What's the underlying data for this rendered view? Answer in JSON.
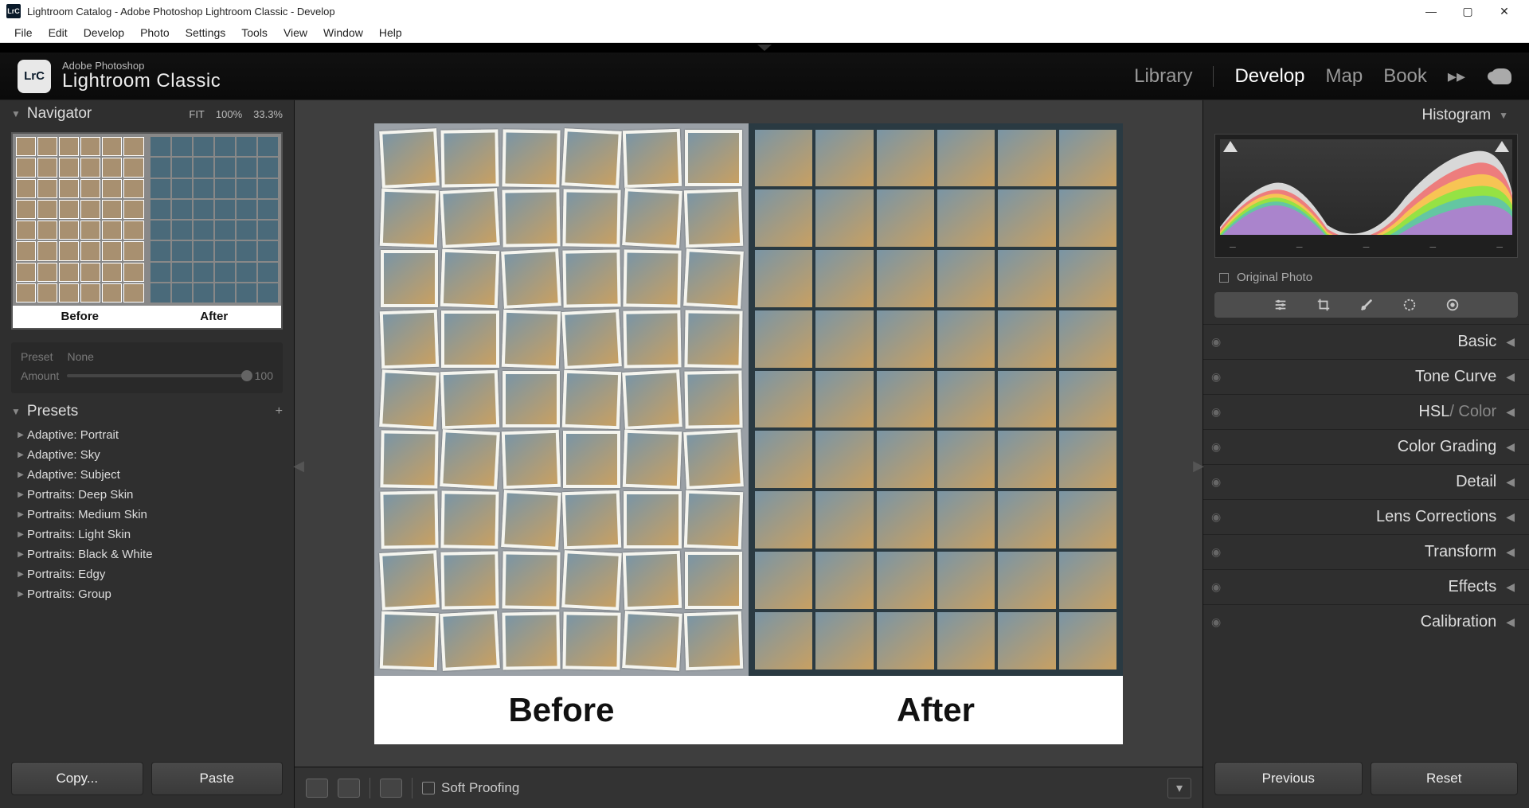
{
  "window": {
    "title": "Lightroom Catalog - Adobe Photoshop Lightroom Classic - Develop",
    "app_icon": "LrC"
  },
  "menu": [
    "File",
    "Edit",
    "Develop",
    "Photo",
    "Settings",
    "Tools",
    "View",
    "Window",
    "Help"
  ],
  "brand": {
    "sup": "Adobe Photoshop",
    "main": "Lightroom Classic",
    "badge": "LrC"
  },
  "modules": {
    "items": [
      "Library",
      "Develop",
      "Map",
      "Book"
    ],
    "active": "Develop"
  },
  "navigator": {
    "title": "Navigator",
    "zoom": [
      "FIT",
      "100%",
      "33.3%"
    ],
    "before": "Before",
    "after": "After"
  },
  "preset_amount": {
    "preset_label": "Preset",
    "preset_value": "None",
    "amount_label": "Amount",
    "amount_value": "100"
  },
  "presets": {
    "title": "Presets",
    "items": [
      "Adaptive: Portrait",
      "Adaptive: Sky",
      "Adaptive: Subject",
      "Portraits: Deep Skin",
      "Portraits: Medium Skin",
      "Portraits: Light Skin",
      "Portraits: Black & White",
      "Portraits: Edgy",
      "Portraits: Group"
    ]
  },
  "buttons": {
    "copy": "Copy...",
    "paste": "Paste",
    "previous": "Previous",
    "reset": "Reset"
  },
  "canvas": {
    "before": "Before",
    "after": "After"
  },
  "soft_proofing": "Soft Proofing",
  "histogram": {
    "title": "Histogram",
    "original": "Original Photo"
  },
  "tool_icons": [
    "sliders-icon",
    "crop-icon",
    "healing-icon",
    "mask-icon",
    "radial-icon"
  ],
  "right_panels": [
    {
      "label": "Basic"
    },
    {
      "label": "Tone Curve"
    },
    {
      "label_a": "HSL",
      "label_b": " / Color"
    },
    {
      "label": "Color Grading"
    },
    {
      "label": "Detail"
    },
    {
      "label": "Lens Corrections"
    },
    {
      "label": "Transform"
    },
    {
      "label": "Effects"
    },
    {
      "label": "Calibration"
    }
  ]
}
